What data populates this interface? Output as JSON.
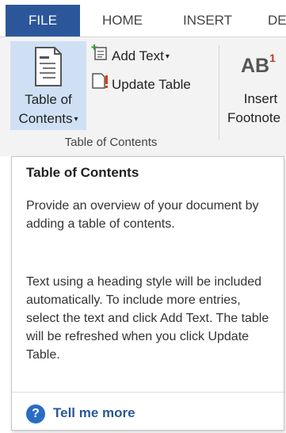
{
  "tabs": {
    "file": "FILE",
    "home": "HOME",
    "insert": "INSERT",
    "design": "DE"
  },
  "ribbon": {
    "toc_button": {
      "line1": "Table of",
      "line2": "Contents",
      "caret": "▾",
      "icon": "toc-document-icon"
    },
    "add_text": {
      "label": "Add Text",
      "caret": "▾",
      "icon": "add-text-icon"
    },
    "update_table": {
      "label": "Update Table",
      "icon": "update-table-icon"
    },
    "group_label": "Table of Contents",
    "footnote": {
      "icon_text": "AB",
      "icon_sup": "1",
      "line1": "Insert",
      "line2": "Footnote"
    }
  },
  "tooltip": {
    "title": "Table of Contents",
    "paragraph1": "Provide an overview of your document by adding a table of contents.",
    "paragraph2": "Text using a heading style will be included automatically. To include more entries, select the text and click Add Text. The table will be refreshed when you click Update Table.",
    "tell_me_more": "Tell me more",
    "help_icon": "?"
  },
  "colors": {
    "file_tab": "#2b579a",
    "ribbon_bg": "#f3f3f3",
    "toc_highlight": "#cfe0f4",
    "link": "#2b579a"
  }
}
